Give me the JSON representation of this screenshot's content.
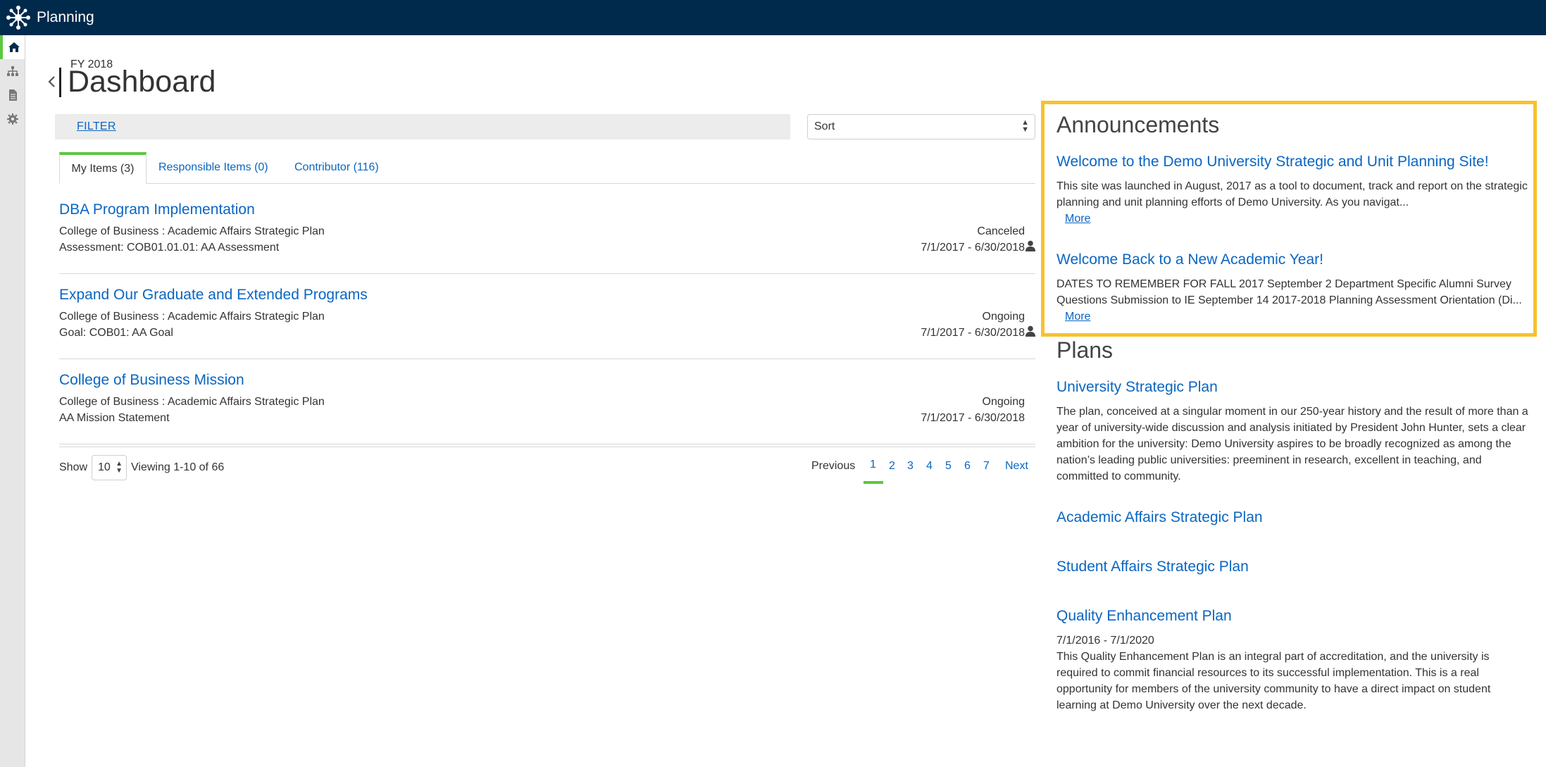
{
  "app": {
    "title": "Planning"
  },
  "header": {
    "fiscal_year": "FY 2018",
    "title": "Dashboard"
  },
  "filter": {
    "label": "FILTER"
  },
  "sort": {
    "selected": "Sort"
  },
  "tabs": [
    {
      "label": "My Items (3)"
    },
    {
      "label": "Responsible Items (0)"
    },
    {
      "label": "Contributor (116)"
    }
  ],
  "items": [
    {
      "title": "DBA Program Implementation",
      "plan": "College of Business : Academic Affairs Strategic Plan",
      "detail": "Assessment: COB01.01.01: AA Assessment",
      "status": "Canceled",
      "dates": "7/1/2017 - 6/30/2018"
    },
    {
      "title": "Expand Our Graduate and Extended Programs",
      "plan": "College of Business : Academic Affairs Strategic Plan",
      "detail": "Goal: COB01: AA Goal",
      "status": "Ongoing",
      "dates": "7/1/2017 - 6/30/2018"
    },
    {
      "title": "College of Business Mission",
      "plan": "College of Business : Academic Affairs Strategic Plan",
      "detail": "AA Mission Statement",
      "status": "Ongoing",
      "dates": "7/1/2017 - 6/30/2018"
    }
  ],
  "paging": {
    "show_label": "Show",
    "page_size": "10",
    "viewing": "Viewing 1-10 of 66",
    "previous": "Previous",
    "pages": [
      "1",
      "2",
      "3",
      "4",
      "5",
      "6",
      "7"
    ],
    "next": "Next",
    "current": "1"
  },
  "announcements": {
    "heading": "Announcements",
    "items": [
      {
        "title": "Welcome to the Demo University Strategic and Unit Planning Site!",
        "text": "This site was launched in August, 2017 as a tool to document, track and report on the strategic planning and unit planning efforts of Demo University. As you navigat...",
        "more": "More"
      },
      {
        "title": "Welcome Back to a New Academic Year!",
        "text": "DATES TO REMEMBER FOR FALL 2017 September 2 Department Specific Alumni Survey Questions Submission to IE September 14 2017-2018 Planning Assessment Orientation (Di...",
        "more": "More"
      }
    ]
  },
  "plans": {
    "heading": "Plans",
    "items": [
      {
        "title": "University Strategic Plan",
        "text": "The plan, conceived at a singular moment in our 250-year history and the result of more than a year of university-wide discussion and analysis initiated by President John Hunter, sets a clear ambition for the university: Demo University aspires to be broadly recognized as among the nation’s leading public universities: preeminent in research, excellent in teaching, and committed to community."
      },
      {
        "title": "Academic Affairs Strategic Plan"
      },
      {
        "title": "Student Affairs Strategic Plan"
      },
      {
        "title": "Quality Enhancement Plan",
        "dates": "7/1/2016 - 7/1/2020",
        "text": "This Quality Enhancement Plan is an integral part of accreditation, and the university is required to commit financial resources to its successful implementation. This is a real opportunity for members of the university community to have a direct impact on student learning at Demo University over the next decade."
      }
    ]
  },
  "colors": {
    "topbar": "#002a4c",
    "accent": "#5ac83e",
    "link": "#0a66c2",
    "highlight": "#f7c22e"
  },
  "icons": {
    "logo": "hub-logo-icon",
    "rail": [
      "home-icon",
      "hierarchy-icon",
      "document-icon",
      "gear-icon"
    ],
    "back": "chevron-left-icon",
    "person": "person-icon"
  }
}
